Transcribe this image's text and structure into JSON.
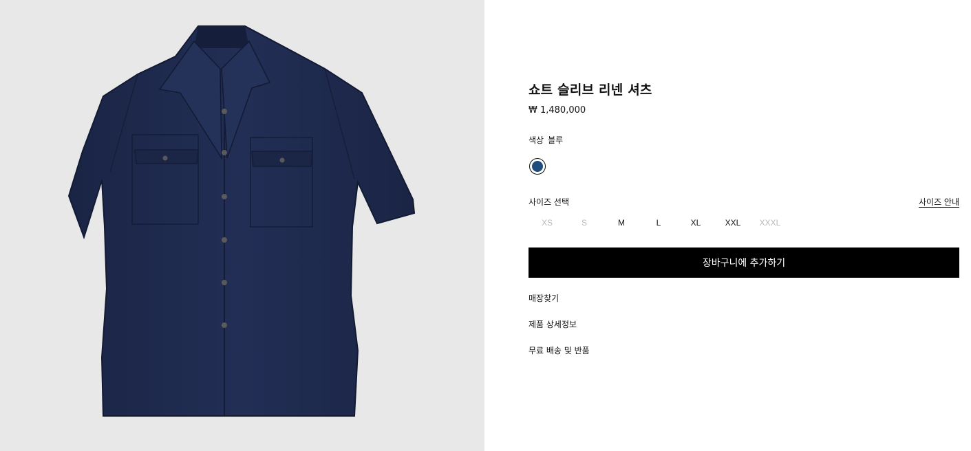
{
  "product": {
    "title": "쇼트 슬리브 리넨 셔츠",
    "price": "₩ 1,480,000",
    "image_alt": "navy-linen-short-sleeve-shirt"
  },
  "color": {
    "label": "색상",
    "value": "블루",
    "swatch_hex": "#1f4e7c"
  },
  "size": {
    "label": "사이즈 선택",
    "guide_label": "사이즈 안내",
    "options": [
      {
        "label": "XS",
        "available": false
      },
      {
        "label": "S",
        "available": false
      },
      {
        "label": "M",
        "available": true
      },
      {
        "label": "L",
        "available": true
      },
      {
        "label": "XL",
        "available": true
      },
      {
        "label": "XXL",
        "available": true
      },
      {
        "label": "XXXL",
        "available": false
      }
    ]
  },
  "cart": {
    "add_label": "장바구니에 추가하기"
  },
  "links": {
    "store_finder": "매장찾기",
    "product_details": "제품 상세정보",
    "shipping_returns": "무료 배송 및 반품"
  },
  "colors": {
    "background_gallery": "#e8e8e8",
    "shirt": "#1e2a4d",
    "button": "#000000"
  }
}
